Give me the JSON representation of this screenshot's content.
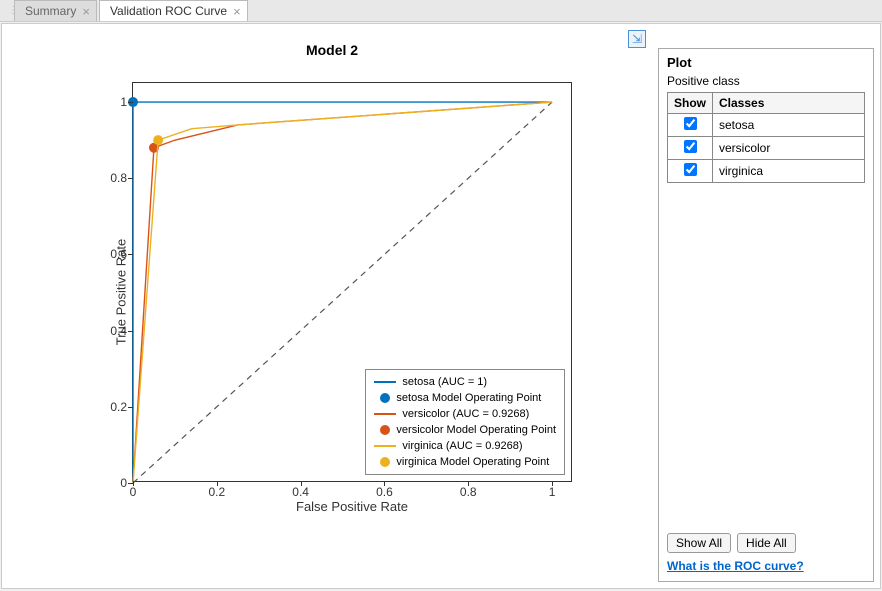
{
  "tabs": [
    {
      "label": "Summary",
      "active": false
    },
    {
      "label": "Validation ROC Curve",
      "active": true
    }
  ],
  "chart_data": {
    "type": "line",
    "title": "Model 2",
    "xlabel": "False Positive Rate",
    "ylabel": "True Positive Rate",
    "xlim": [
      0,
      1.05
    ],
    "ylim": [
      0,
      1.05
    ],
    "xticks": [
      0,
      0.2,
      0.4,
      0.6,
      0.8,
      1
    ],
    "yticks": [
      0,
      0.2,
      0.4,
      0.6,
      0.8,
      1
    ],
    "diagonal": {
      "from": [
        0,
        0
      ],
      "to": [
        1,
        1
      ],
      "style": "dashed",
      "color": "#555"
    },
    "series": [
      {
        "name": "setosa (AUC = 1)",
        "color": "#0072bd",
        "points": [
          [
            0,
            0
          ],
          [
            0,
            1
          ],
          [
            1,
            1
          ]
        ],
        "operating_point": {
          "x": 0.0,
          "y": 1.0,
          "label": "setosa Model Operating Point"
        }
      },
      {
        "name": "versicolor (AUC = 0.9268)",
        "color": "#d95319",
        "points": [
          [
            0,
            0
          ],
          [
            0.05,
            0.88
          ],
          [
            0.1,
            0.9
          ],
          [
            0.25,
            0.94
          ],
          [
            1,
            1
          ]
        ],
        "operating_point": {
          "x": 0.05,
          "y": 0.88,
          "label": "versicolor Model Operating Point"
        }
      },
      {
        "name": "virginica (AUC = 0.9268)",
        "color": "#edb120",
        "points": [
          [
            0,
            0
          ],
          [
            0.06,
            0.9
          ],
          [
            0.14,
            0.93
          ],
          [
            0.25,
            0.94
          ],
          [
            1,
            1
          ]
        ],
        "operating_point": {
          "x": 0.06,
          "y": 0.9,
          "label": "virginica Model Operating Point"
        }
      }
    ],
    "legend_entries": [
      {
        "kind": "line",
        "color": "#0072bd",
        "label": "setosa (AUC = 1)"
      },
      {
        "kind": "dot",
        "color": "#0072bd",
        "label": "setosa Model Operating Point"
      },
      {
        "kind": "line",
        "color": "#d95319",
        "label": "versicolor (AUC = 0.9268)"
      },
      {
        "kind": "dot",
        "color": "#d95319",
        "label": "versicolor Model Operating Point"
      },
      {
        "kind": "line",
        "color": "#edb120",
        "label": "virginica (AUC = 0.9268)"
      },
      {
        "kind": "dot",
        "color": "#edb120",
        "label": "virginica Model Operating Point"
      }
    ]
  },
  "side_panel": {
    "title": "Plot",
    "subtitle": "Positive class",
    "table": {
      "headers": [
        "Show",
        "Classes"
      ],
      "rows": [
        {
          "checked": true,
          "class": "setosa"
        },
        {
          "checked": true,
          "class": "versicolor"
        },
        {
          "checked": true,
          "class": "virginica"
        }
      ]
    },
    "show_all": "Show All",
    "hide_all": "Hide All",
    "help_link": "What is the ROC curve?"
  }
}
